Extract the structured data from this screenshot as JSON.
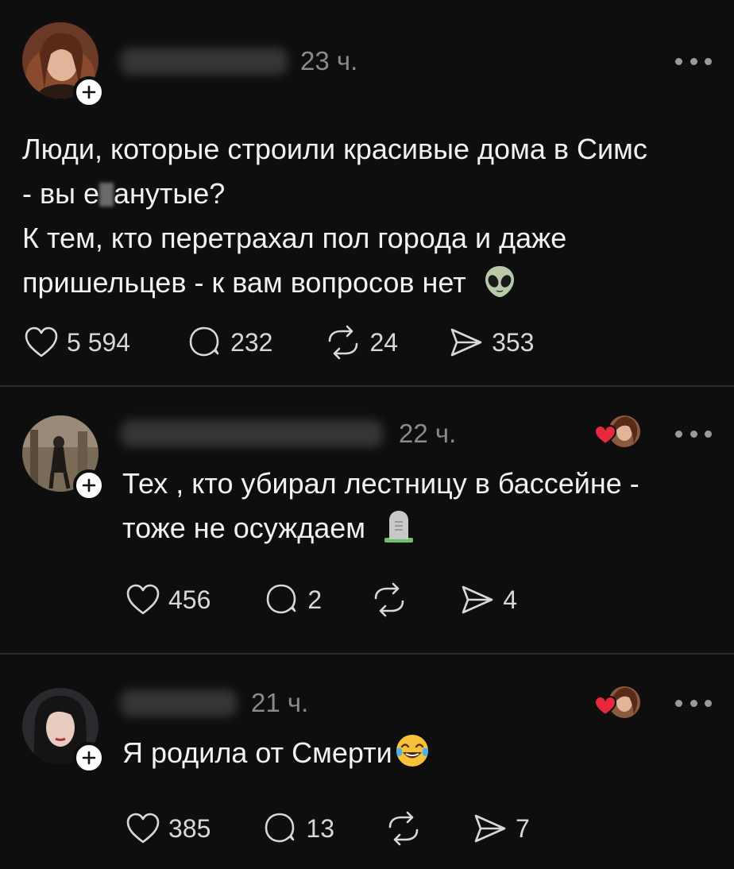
{
  "colors": {
    "background": "#0e0e0e",
    "text": "#f2f2f2",
    "muted": "#8a8a8a",
    "divider": "#2a2a2a",
    "heart_red": "#e8283c"
  },
  "posts": [
    {
      "time": "23 ч.",
      "text_lines": [
        "Люди, которые строили красивые дома в Симс",
        "- вы е",
        "анутые?",
        "К тем, кто перетрахал пол города и даже",
        "пришельцев - к вам вопросов нет"
      ],
      "emoji": "alien-face-emoji",
      "likes": "5 594",
      "replies": "232",
      "reposts": "24",
      "shares": "353"
    },
    {
      "time": "22 ч.",
      "text_lines": [
        "Тех , кто убирал лестницу в бассейне -",
        "тоже не осуждаем"
      ],
      "emoji": "headstone-emoji",
      "likes": "456",
      "replies": "2",
      "reposts": "",
      "shares": "4"
    },
    {
      "time": "21 ч.",
      "text_lines": [
        "Я родила от Смерти"
      ],
      "emoji": "tears-of-joy-emoji",
      "likes": "385",
      "replies": "13",
      "reposts": "",
      "shares": "7"
    }
  ]
}
